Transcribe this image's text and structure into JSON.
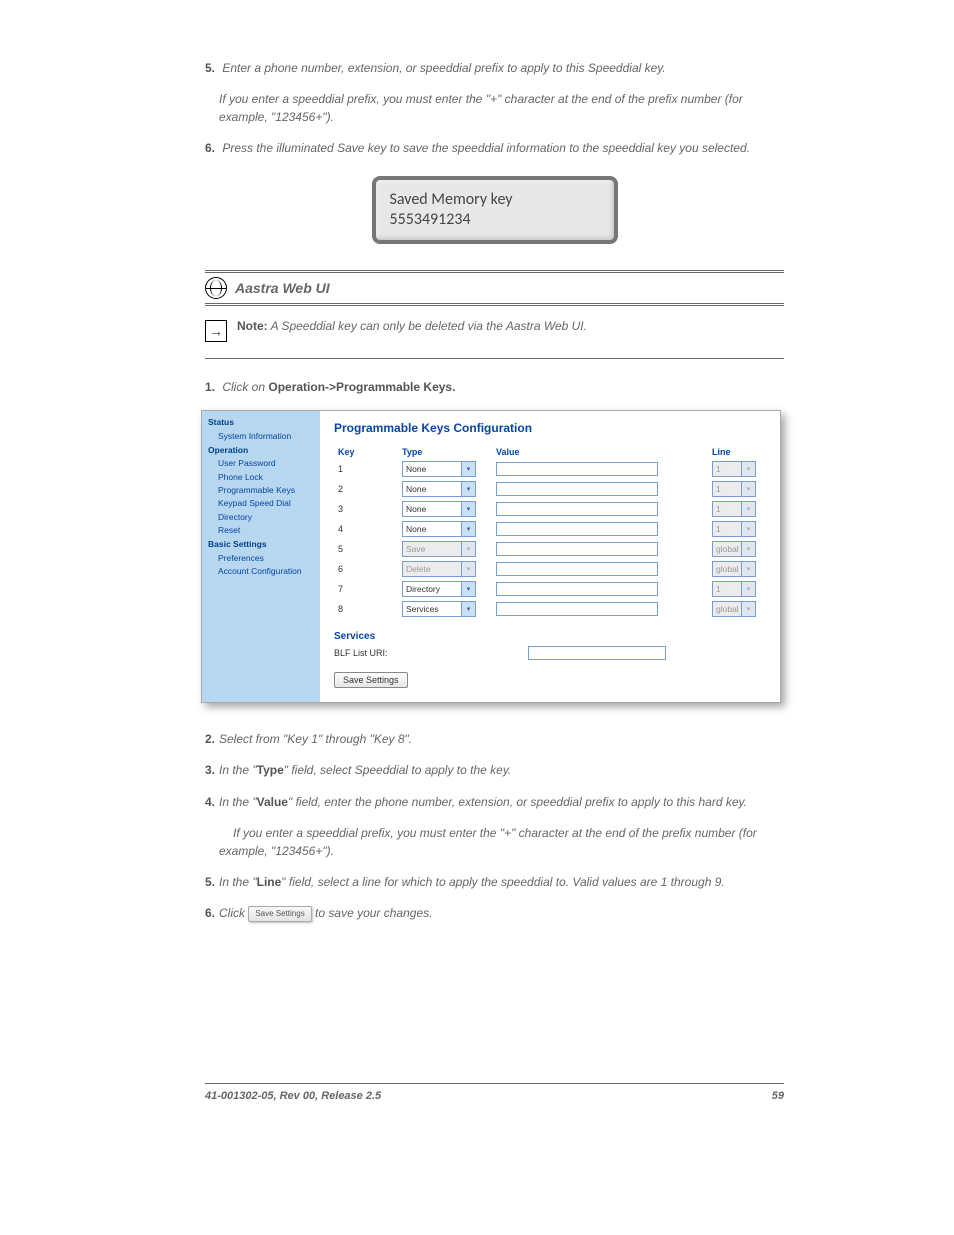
{
  "step5": "Enter a phone number, extension, or speeddial prefix to apply to this Speeddial key.",
  "step5_sub": "If you enter a speeddial prefix, you must enter the \"+\" character at the end of the prefix number (for example, \"123456+\").",
  "step6": "Press the illuminated Save key to save the speeddial information to the speeddial key you selected.",
  "lcd": {
    "line1": "Saved Memory key",
    "line2": "5553491234"
  },
  "section_heading": "Aastra Web UI",
  "note_label": "Note:",
  "note_text": "A Speeddial key can only be deleted via the Aastra Web UI.",
  "ui": {
    "title": "Programmable Keys Configuration",
    "sidebar": {
      "groups": [
        {
          "header": "Status",
          "items": [
            "System Information"
          ]
        },
        {
          "header": "Operation",
          "items": [
            "User Password",
            "Phone Lock",
            "Programmable Keys",
            "Keypad Speed Dial",
            "Directory",
            "Reset"
          ]
        },
        {
          "header": "Basic Settings",
          "items": [
            "Preferences",
            "Account Configuration"
          ]
        }
      ]
    },
    "table": {
      "headers": {
        "key": "Key",
        "type": "Type",
        "value": "Value",
        "line": "Line"
      },
      "rows": [
        {
          "key": "1",
          "type": "None",
          "type_disabled": false,
          "value": "",
          "line": "1",
          "line_disabled": true
        },
        {
          "key": "2",
          "type": "None",
          "type_disabled": false,
          "value": "",
          "line": "1",
          "line_disabled": true
        },
        {
          "key": "3",
          "type": "None",
          "type_disabled": false,
          "value": "",
          "line": "1",
          "line_disabled": true
        },
        {
          "key": "4",
          "type": "None",
          "type_disabled": false,
          "value": "",
          "line": "1",
          "line_disabled": true
        },
        {
          "key": "5",
          "type": "Save",
          "type_disabled": true,
          "value": "",
          "line": "global",
          "line_disabled": true
        },
        {
          "key": "6",
          "type": "Delete",
          "type_disabled": true,
          "value": "",
          "line": "global",
          "line_disabled": true
        },
        {
          "key": "7",
          "type": "Directory",
          "type_disabled": false,
          "value": "",
          "line": "1",
          "line_disabled": true
        },
        {
          "key": "8",
          "type": "Services",
          "type_disabled": false,
          "value": "",
          "line": "global",
          "line_disabled": true
        }
      ]
    },
    "services_label": "Services",
    "blf_label": "BLF List URI:",
    "save_button": "Save Settings"
  },
  "click_text": "Click on Operation->Programmable Keys.",
  "steps": [
    {
      "n": "2.",
      "t": "Select from \"Key 1\" through \"Key 8\"."
    },
    {
      "n": "3.",
      "t_pre": "In the \"",
      "t_bold": "Type",
      "t_post": "\" field, select Speeddial to apply to the key."
    },
    {
      "n": "4.",
      "t_pre": "In the \"",
      "t_bold": "Value",
      "t_post": "\" field, enter the phone number, extension, or speeddial prefix to apply to this hard key."
    },
    {
      "n": "",
      "t": "If you enter a speeddial prefix, you must enter the \"+\" character at the end of the prefix number (for example, \"123456+\")."
    },
    {
      "n": "5.",
      "t_pre": "In the \"",
      "t_bold": "Line",
      "t_post": "\" field, select a line for which to apply the speeddial to. Valid values are 1 through 9."
    },
    {
      "n": "6.",
      "t_pre": "Click ",
      "button": "Save Settings",
      "t_post": " to save your changes."
    }
  ],
  "footer": {
    "left": "41-001302-05, Rev 00, Release 2.5",
    "right": "59"
  }
}
